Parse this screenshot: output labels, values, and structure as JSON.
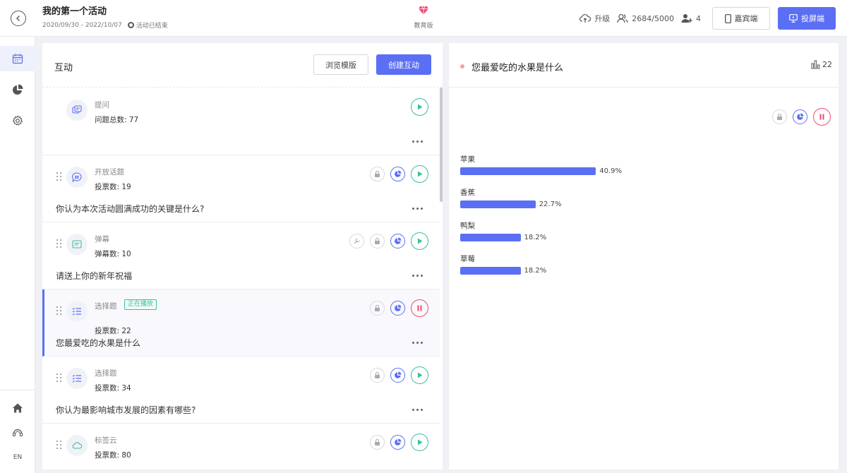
{
  "header": {
    "title": "我的第一个活动",
    "date_range": "2020/09/30 - 2022/10/07",
    "status": "活动已结束",
    "edition": "教育版",
    "upgrade": "升级",
    "participants": "2684/5000",
    "admins": "4",
    "guest_btn": "嘉宾端",
    "screen_btn": "投屏端"
  },
  "leftnav": {
    "lang": "EN"
  },
  "panel": {
    "title": "互动",
    "browse_btn": "浏览模版",
    "create_btn": "创建互动"
  },
  "cards": [
    {
      "type": "提问",
      "count": "问题总数: 77",
      "question": ""
    },
    {
      "type": "开放话题",
      "count": "投票数: 19",
      "question": "你认为本次活动圆满成功的关键是什么?"
    },
    {
      "type": "弹幕",
      "count": "弹幕数: 10",
      "question": "请送上你的新年祝福"
    },
    {
      "type": "选择题",
      "badge": "正在播放",
      "count": "投票数: 22",
      "question": "您最爱吃的水果是什么"
    },
    {
      "type": "选择题",
      "count": "投票数: 34",
      "question": "你认为最影响城市发展的因素有哪些?"
    },
    {
      "type": "标签云",
      "count": "投票数: 80",
      "question": ""
    }
  ],
  "detail": {
    "title": "您最爱吃的水果是什么",
    "vote_count": "22",
    "results": [
      {
        "label": "苹果",
        "pct": "40.9%",
        "value": 40.9
      },
      {
        "label": "香蕉",
        "pct": "22.7%",
        "value": 22.7
      },
      {
        "label": "鸭梨",
        "pct": "18.2%",
        "value": 18.2
      },
      {
        "label": "草莓",
        "pct": "18.2%",
        "value": 18.2
      }
    ]
  },
  "colors": {
    "accent": "#5b6ff5",
    "play": "#3cbf9d",
    "pause": "#ef4b6e"
  },
  "icons": {
    "back": "arrow-left-icon",
    "edition": "diamond-icon",
    "upgrade": "cloud-upload-icon",
    "participants": "users-icon",
    "admins": "admin-icon",
    "guest": "phone-icon",
    "screen": "monitor-icon",
    "nav": [
      "calendar-icon",
      "pie-chart-icon",
      "settings-icon",
      "home-icon",
      "support-icon"
    ]
  }
}
